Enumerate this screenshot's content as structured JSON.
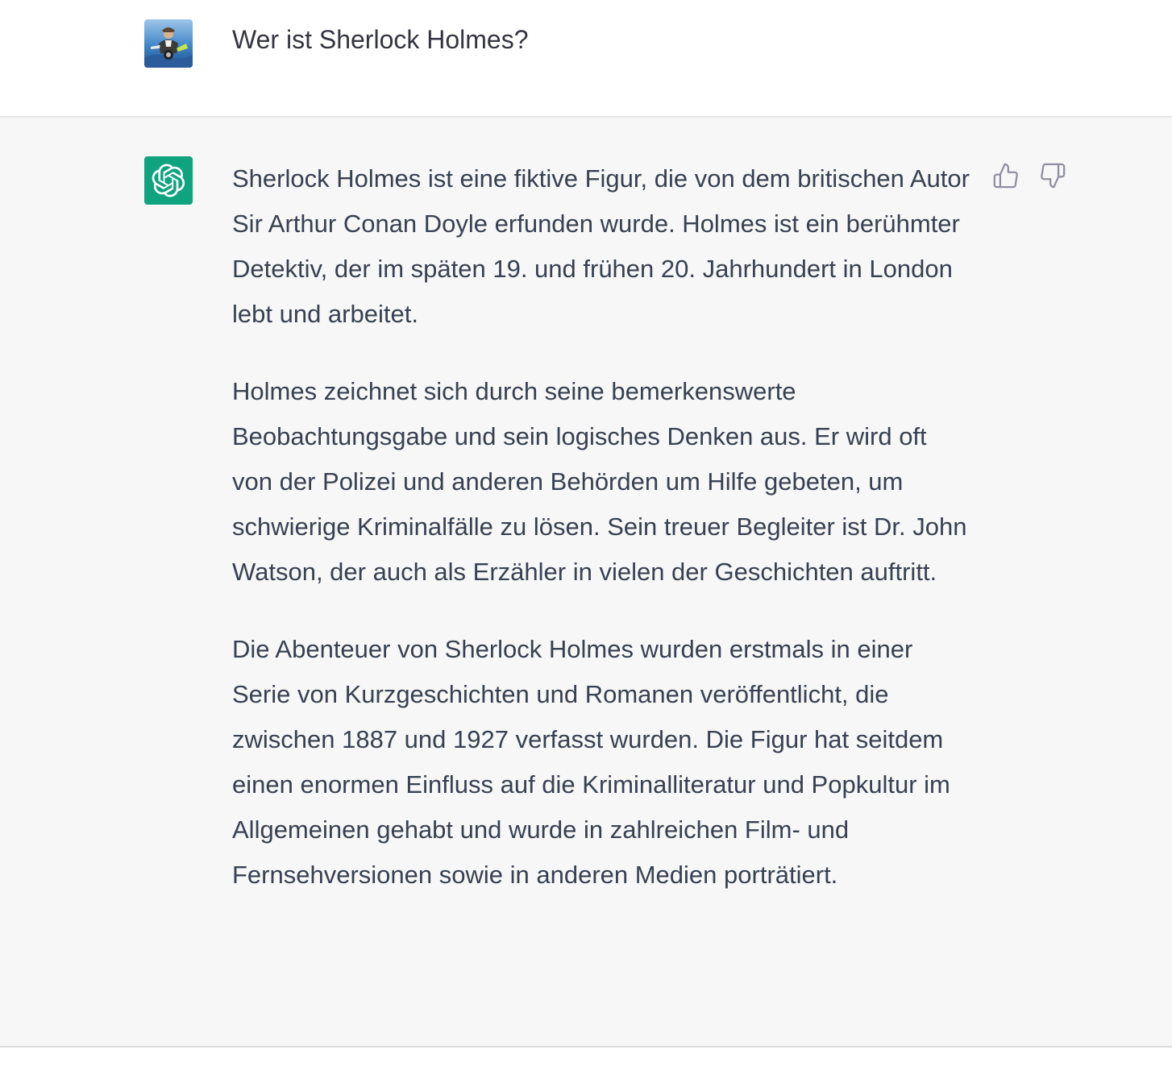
{
  "user": {
    "message": "Wer ist Sherlock Holmes?"
  },
  "assistant": {
    "paragraphs": [
      "Sherlock Holmes ist eine fiktive Figur, die von dem britischen Autor Sir Arthur Conan Doyle erfunden wurde. Holmes ist ein berühmter Detektiv, der im späten 19. und frühen 20. Jahrhundert in London lebt und arbeitet.",
      "Holmes zeichnet sich durch seine bemerkenswerte Beobachtungsgabe und sein logisches Denken aus. Er wird oft von der Polizei und anderen Behörden um Hilfe gebeten, um schwierige Kriminalfälle zu lösen. Sein treuer Begleiter ist Dr. John Watson, der auch als Erzähler in vielen der Geschichten auftritt.",
      "Die Abenteuer von Sherlock Holmes wurden erstmals in einer Serie von Kurzgeschichten und Romanen veröffentlicht, die zwischen 1887 und 1927 verfasst wurden. Die Figur hat seitdem einen enormen Einfluss auf die Kriminalliteratur und Popkultur im Allgemeinen gehabt und wurde in zahlreichen Film- und Fernsehversionen sowie in anderen Medien porträtiert."
    ]
  },
  "icons": {
    "user_avatar": "user-avatar-image",
    "assistant_avatar": "openai-logo-icon",
    "thumbs_up": "thumbs-up-icon",
    "thumbs_down": "thumbs-down-icon"
  },
  "colors": {
    "assistant_bg": "#f7f7f8",
    "assistant_avatar_bg": "#10a37f",
    "text": "#374151",
    "icon": "#8e8ea0"
  }
}
